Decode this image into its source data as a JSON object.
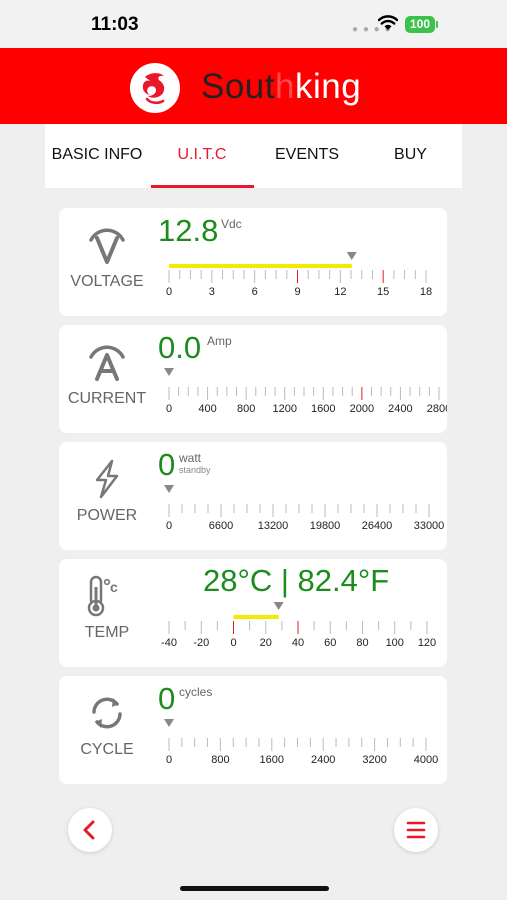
{
  "status": {
    "time": "11:03",
    "battery": "100"
  },
  "brand": {
    "name_a": "Sout",
    "name_b": "h",
    "name_c": "king",
    "color": "#ff0000"
  },
  "tabs": [
    {
      "label": "BASIC INFO"
    },
    {
      "label": "U.I.T.C",
      "active": true
    },
    {
      "label": "EVENTS"
    },
    {
      "label": "BUY"
    }
  ],
  "metrics": {
    "voltage": {
      "label": "VOLTAGE",
      "icon": "voltage-icon",
      "value": "12.8",
      "unit": "Vdc",
      "ticks": [
        "0",
        "3",
        "6",
        "9",
        "12",
        "15",
        "18"
      ],
      "reading": 12.8,
      "max": 18
    },
    "current": {
      "label": "CURRENT",
      "icon": "current-icon",
      "value": "0.0",
      "unit": "Amp",
      "ticks": [
        "0",
        "400",
        "800",
        "1200",
        "1600",
        "2000",
        "2400",
        "2800"
      ],
      "reading": 0,
      "max": 2800
    },
    "power": {
      "label": "POWER",
      "icon": "lightning-icon",
      "value": "0",
      "unit": "watt",
      "sub": "standby",
      "ticks": [
        "0",
        "6600",
        "13200",
        "19800",
        "26400",
        "33000"
      ],
      "reading": 0,
      "max": 33000
    },
    "temp": {
      "label": "TEMP",
      "icon": "thermometer-icon",
      "value": "28°C | 82.4°F",
      "ticks": [
        "-40",
        "-20",
        "0",
        "20",
        "40",
        "60",
        "80",
        "100",
        "120"
      ],
      "reading": 28,
      "min": -40,
      "max": 120
    },
    "cycle": {
      "label": "CYCLE",
      "icon": "cycle-icon",
      "value": "0",
      "unit": "cycles",
      "ticks": [
        "0",
        "800",
        "1600",
        "2400",
        "3200",
        "4000"
      ],
      "reading": 0,
      "max": 4000
    }
  },
  "colors": {
    "accent": "#e8192c",
    "value_green": "#1c8c1c",
    "gauge_fill": "#f4ea00"
  },
  "nav": {
    "back_icon": "chevron-left-icon",
    "menu_icon": "menu-icon"
  }
}
